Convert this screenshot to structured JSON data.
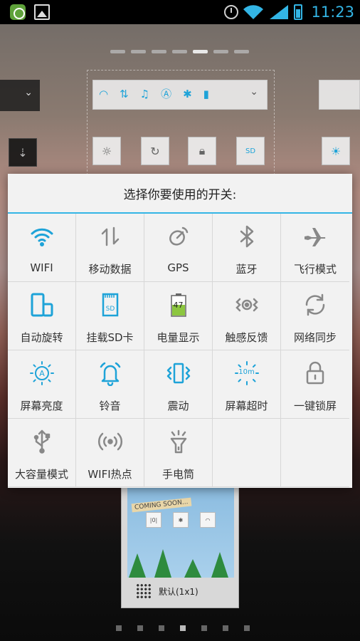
{
  "status_bar": {
    "time": "11:23"
  },
  "dialog": {
    "title": "选择你要使用的开关:",
    "switches": [
      {
        "label": "WIFI",
        "icon": "wifi-icon"
      },
      {
        "label": "移动数据",
        "icon": "mobile-data-icon"
      },
      {
        "label": "GPS",
        "icon": "gps-icon"
      },
      {
        "label": "蓝牙",
        "icon": "bluetooth-icon"
      },
      {
        "label": "飞行模式",
        "icon": "airplane-icon"
      },
      {
        "label": "自动旋转",
        "icon": "auto-rotate-icon"
      },
      {
        "label": "挂载SD卡",
        "icon": "sd-card-icon"
      },
      {
        "label": "电量显示",
        "icon": "battery-icon",
        "value": "47"
      },
      {
        "label": "触感反馈",
        "icon": "haptic-icon"
      },
      {
        "label": "网络同步",
        "icon": "sync-icon"
      },
      {
        "label": "屏幕亮度",
        "icon": "brightness-icon"
      },
      {
        "label": "铃音",
        "icon": "ringtone-icon"
      },
      {
        "label": "震动",
        "icon": "vibrate-icon"
      },
      {
        "label": "屏幕超时",
        "icon": "screen-timeout-icon",
        "value": "10m"
      },
      {
        "label": "一键锁屏",
        "icon": "lock-icon"
      },
      {
        "label": "大容量模式",
        "icon": "usb-icon"
      },
      {
        "label": "WIFI热点",
        "icon": "hotspot-icon"
      },
      {
        "label": "手电筒",
        "icon": "flashlight-icon"
      },
      {
        "label": "",
        "icon": ""
      },
      {
        "label": "",
        "icon": ""
      }
    ]
  },
  "preview": {
    "label": "默认(1x1)",
    "banner": "COMING SOON..."
  },
  "colors": {
    "accent": "#33b5e5",
    "icon": "#1ea3d8"
  }
}
